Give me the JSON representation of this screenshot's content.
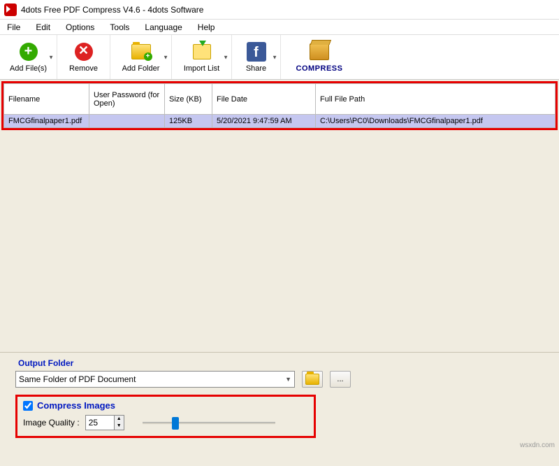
{
  "window": {
    "title": "4dots Free PDF Compress V4.6 - 4dots Software"
  },
  "menu": {
    "items": [
      "File",
      "Edit",
      "Options",
      "Tools",
      "Language",
      "Help"
    ]
  },
  "toolbar": {
    "add_files": "Add File(s)",
    "remove": "Remove",
    "add_folder": "Add Folder",
    "import_list": "Import List",
    "share": "Share",
    "compress": "COMPRESS"
  },
  "table": {
    "headers": {
      "filename": "Filename",
      "password": "User Password (for Open)",
      "size": "Size (KB)",
      "filedate": "File Date",
      "fullpath": "Full File Path"
    },
    "rows": [
      {
        "filename": "FMCGfinalpaper1.pdf",
        "password": "",
        "size": "125KB",
        "filedate": "5/20/2021 9:47:59 AM",
        "fullpath": "C:\\Users\\PC0\\Downloads\\FMCGfinalpaper1.pdf"
      }
    ]
  },
  "output": {
    "group_label": "Output Folder",
    "combo_value": "Same Folder of PDF Document",
    "browse_label": "..."
  },
  "compress_images": {
    "checkbox_label": "Compress Images",
    "checked": true,
    "quality_label": "Image Quality :",
    "quality_value": "25",
    "slider_percent": 25
  },
  "watermark": "wsxdn.com"
}
